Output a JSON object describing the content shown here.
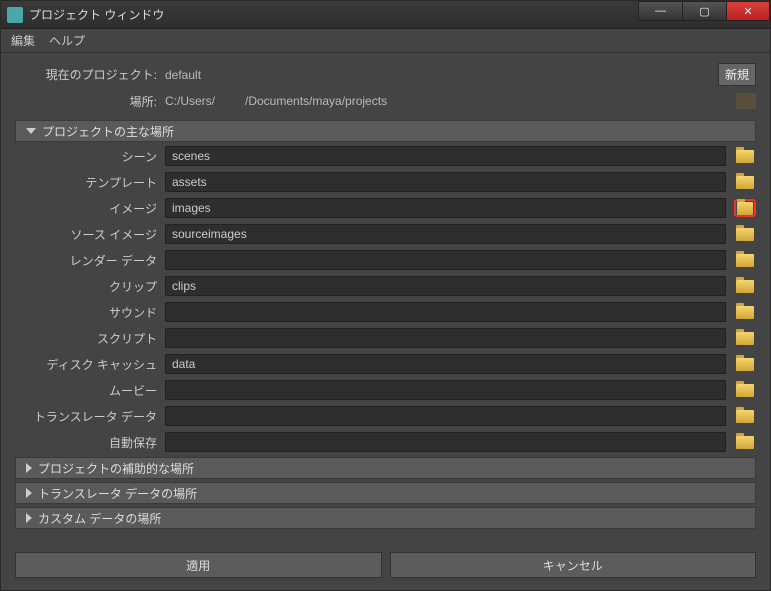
{
  "window": {
    "title": "プロジェクト ウィンドウ"
  },
  "menu": {
    "edit": "編集",
    "help": "ヘルプ"
  },
  "project": {
    "current_label": "現在のプロジェクト:",
    "current_value": "default",
    "new_btn": "新規",
    "location_label": "場所:",
    "location_value": "C:/Users/         /Documents/maya/projects"
  },
  "sections": {
    "primary": "プロジェクトの主な場所",
    "secondary": "プロジェクトの補助的な場所",
    "translator": "トランスレータ データの場所",
    "custom": "カスタム データの場所"
  },
  "fields": [
    {
      "label": "シーン",
      "value": "scenes",
      "highlight": false
    },
    {
      "label": "テンプレート",
      "value": "assets",
      "highlight": false
    },
    {
      "label": "イメージ",
      "value": "images",
      "highlight": true
    },
    {
      "label": "ソース イメージ",
      "value": "sourceimages",
      "highlight": false
    },
    {
      "label": "レンダー データ",
      "value": "",
      "highlight": false
    },
    {
      "label": "クリップ",
      "value": "clips",
      "highlight": false
    },
    {
      "label": "サウンド",
      "value": "",
      "highlight": false
    },
    {
      "label": "スクリプト",
      "value": "",
      "highlight": false
    },
    {
      "label": "ディスク キャッシュ",
      "value": "data",
      "highlight": false
    },
    {
      "label": "ムービー",
      "value": "",
      "highlight": false
    },
    {
      "label": "トランスレータ データ",
      "value": "",
      "highlight": false
    },
    {
      "label": "自動保存",
      "value": "",
      "highlight": false
    }
  ],
  "footer": {
    "apply": "適用",
    "cancel": "キャンセル"
  }
}
